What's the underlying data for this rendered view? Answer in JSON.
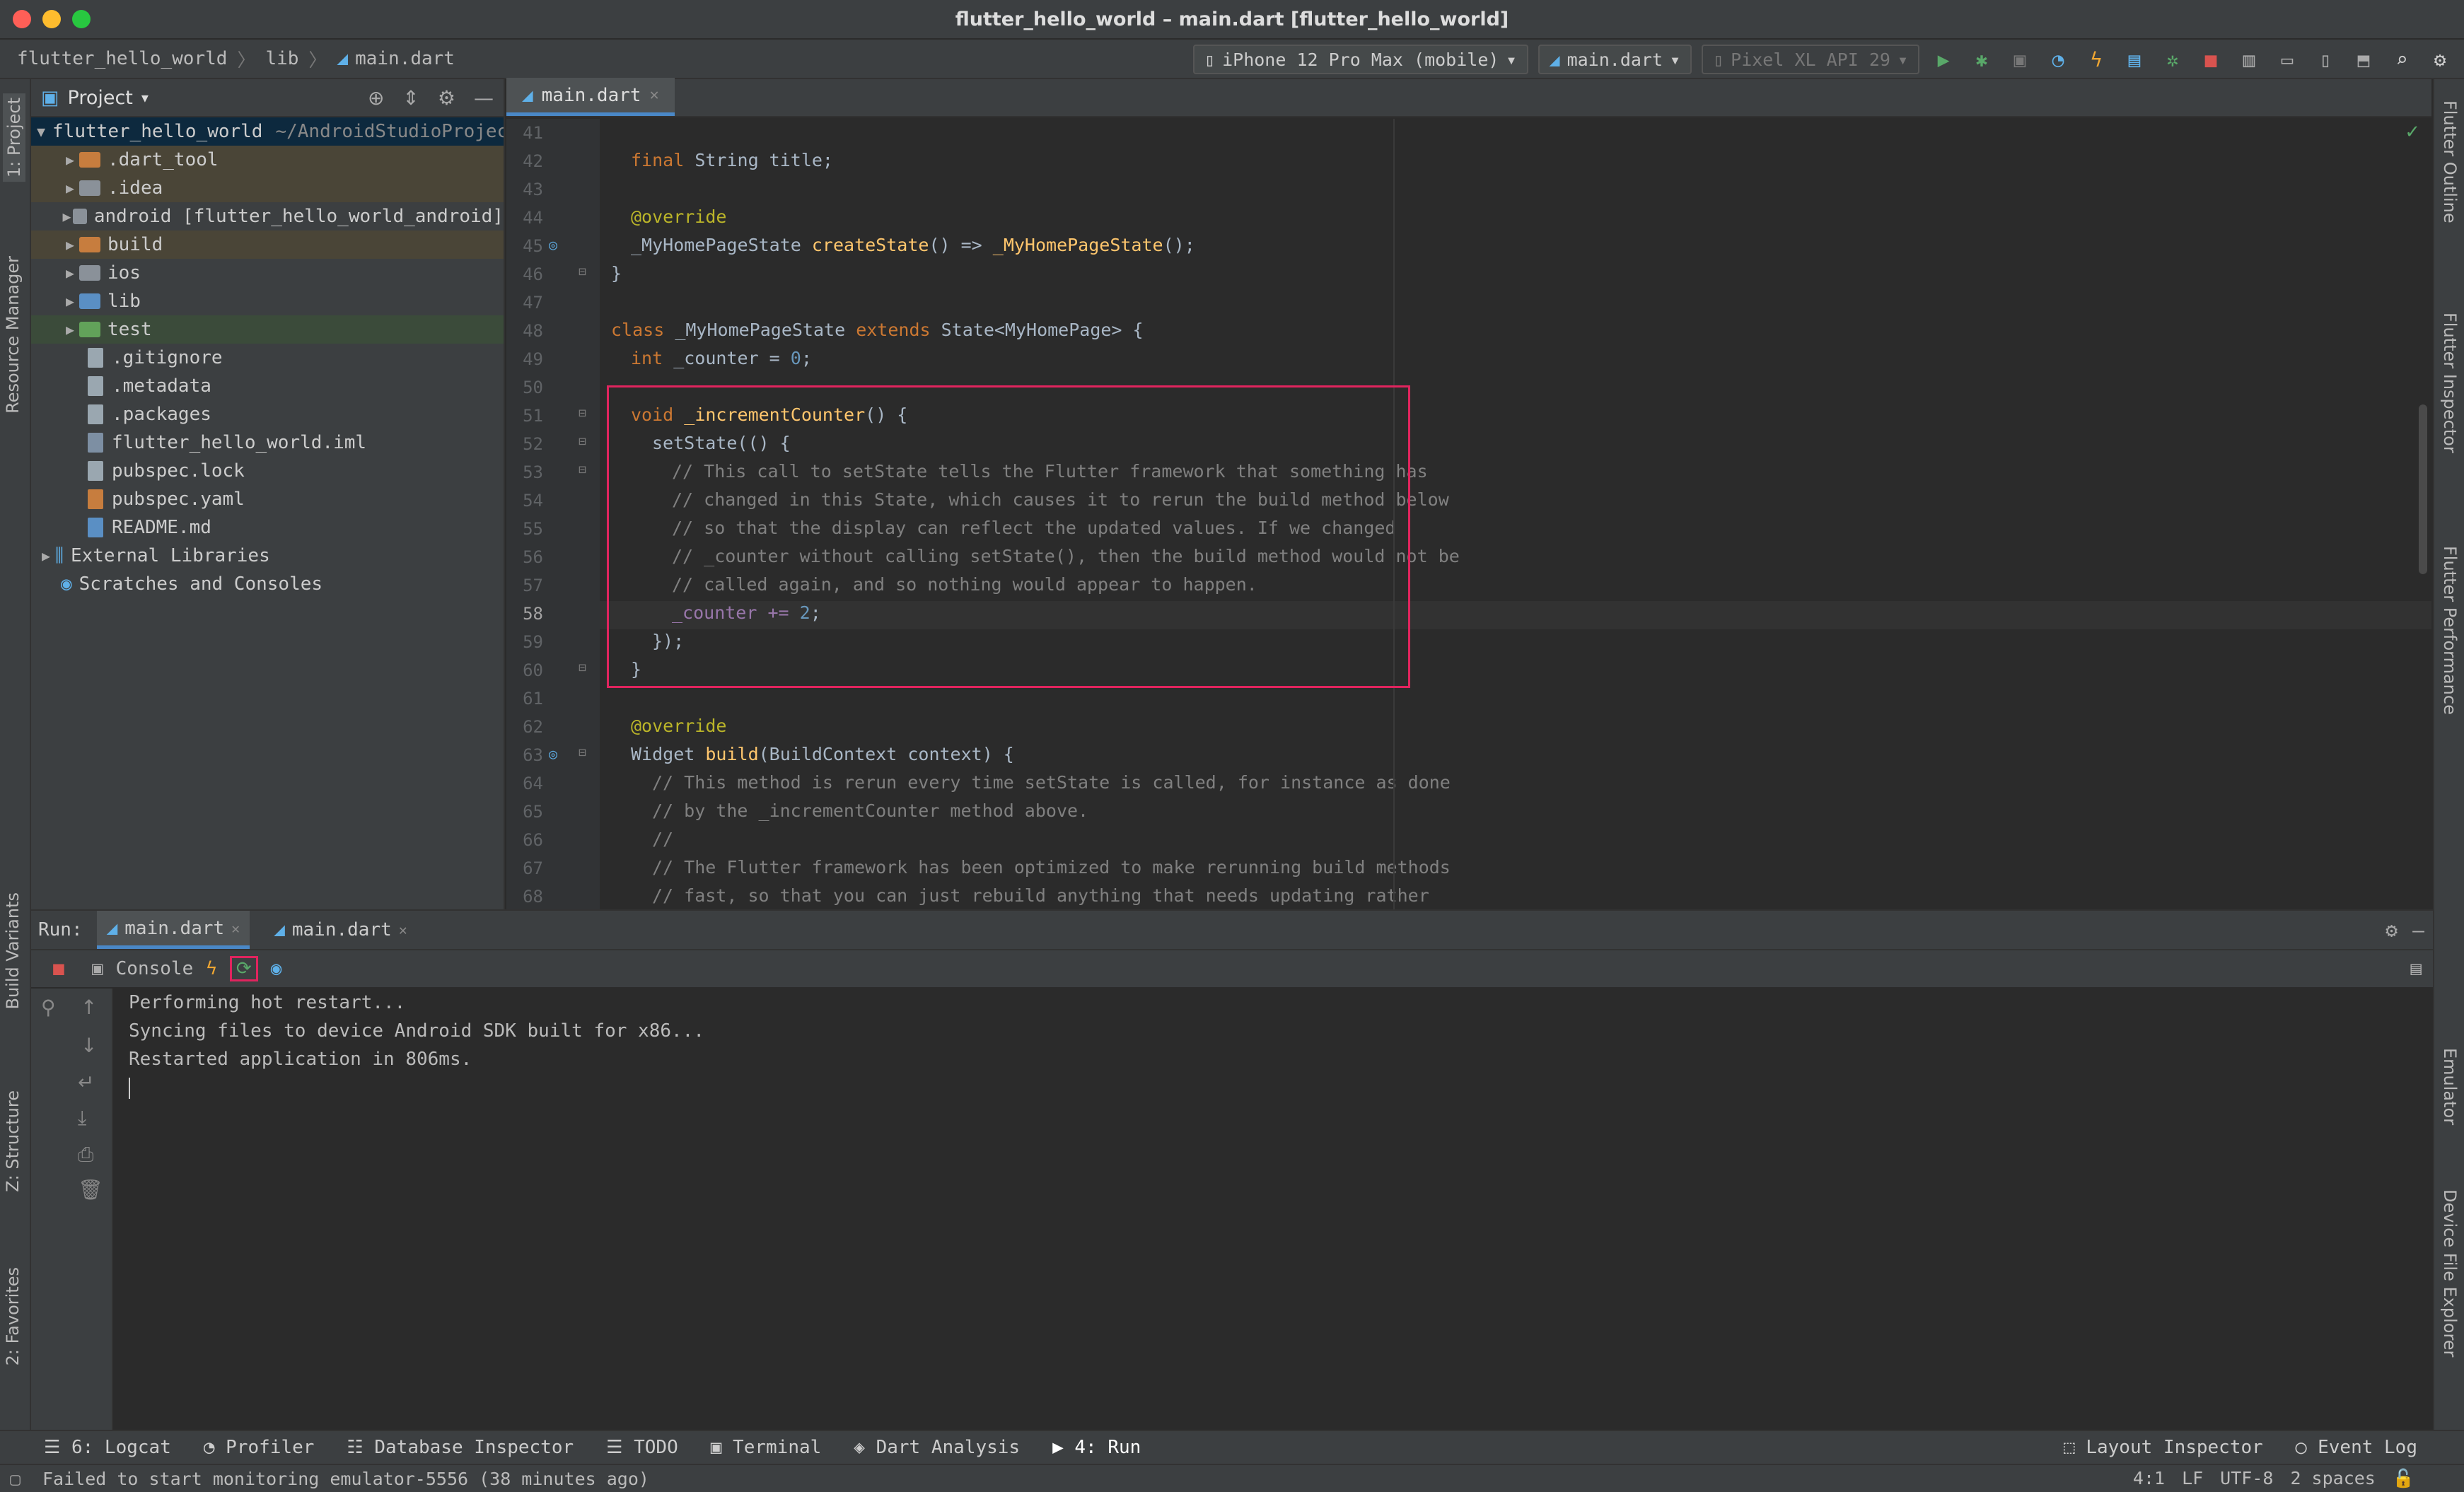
{
  "window": {
    "title": "flutter_hello_world – main.dart [flutter_hello_world]"
  },
  "breadcrumb": [
    "flutter_hello_world",
    "lib",
    "main.dart"
  ],
  "toolbar": {
    "device": "iPhone 12 Pro Max (mobile)",
    "config": "main.dart",
    "emulator": "Pixel XL API 29"
  },
  "left_stripe": [
    "1: Project",
    "Resource Manager",
    "Build Variants",
    "Z: Structure",
    "2: Favorites"
  ],
  "right_stripe": [
    "Flutter Outline",
    "Flutter Inspector",
    "Flutter Performance",
    "Emulator",
    "Device File Explorer"
  ],
  "project": {
    "title": "Project",
    "root_name": "flutter_hello_world",
    "root_path": "~/AndroidStudioProjec",
    "items": [
      {
        "label": ".dart_tool",
        "type": "folder"
      },
      {
        "label": ".idea",
        "type": "folder"
      },
      {
        "label": "android [flutter_hello_world_android]",
        "type": "folder"
      },
      {
        "label": "build",
        "type": "folder"
      },
      {
        "label": "ios",
        "type": "folder"
      },
      {
        "label": "lib",
        "type": "folder"
      },
      {
        "label": "test",
        "type": "folder"
      },
      {
        "label": ".gitignore",
        "type": "file"
      },
      {
        "label": ".metadata",
        "type": "file"
      },
      {
        "label": ".packages",
        "type": "file"
      },
      {
        "label": "flutter_hello_world.iml",
        "type": "file"
      },
      {
        "label": "pubspec.lock",
        "type": "file"
      },
      {
        "label": "pubspec.yaml",
        "type": "file"
      },
      {
        "label": "README.md",
        "type": "file"
      }
    ],
    "external": "External Libraries",
    "scratches": "Scratches and Consoles"
  },
  "editor": {
    "tab": "main.dart",
    "line_numbers": [
      "41",
      "42",
      "43",
      "44",
      "45",
      "46",
      "47",
      "48",
      "49",
      "50",
      "51",
      "52",
      "53",
      "54",
      "55",
      "56",
      "57",
      "58",
      "59",
      "60",
      "61",
      "62",
      "63",
      "64",
      "65",
      "66",
      "67",
      "68"
    ],
    "current_line": "58",
    "code": {
      "l42_kw": "final",
      "l42_rest": " String title;",
      "l44": "@override",
      "l45_a": "_MyHomePageState ",
      "l45_fn": "createState",
      "l45_b": "() => ",
      "l45_fn2": "_MyHomePageState",
      "l45_c": "();",
      "l46": "}",
      "l48_kw": "class",
      "l48_a": " _MyHomePageState ",
      "l48_kw2": "extends",
      "l48_b": " State<MyHomePage> {",
      "l49_kw": "int",
      "l49_a": " _counter = ",
      "l49_num": "0",
      "l49_b": ";",
      "l51_kw": "void",
      "l51_fn": " _incrementCounter",
      "l51_a": "() {",
      "l52": "setState(() {",
      "l53": "// This call to setState tells the Flutter framework that something has",
      "l54": "// changed in this State, which causes it to rerun the build method below",
      "l55": "// so that the display can reflect the updated values. If we changed",
      "l56": "// _counter without calling setState(), then the build method would not be",
      "l57": "// called again, and so nothing would appear to happen.",
      "l58_a": "_counter += ",
      "l58_num": "2",
      "l58_b": ";",
      "l59": "});",
      "l60": "}",
      "l62": "@override",
      "l63_a": "Widget ",
      "l63_fn": "build",
      "l63_b": "(BuildContext context) {",
      "l64": "// This method is rerun every time setState is called, for instance as done",
      "l65": "// by the _incrementCounter method above.",
      "l66": "//",
      "l67": "// The Flutter framework has been optimized to make rerunning build methods",
      "l68": "// fast, so that you can just rebuild anything that needs updating rather"
    }
  },
  "run": {
    "label": "Run:",
    "tabs": [
      "main.dart",
      "main.dart"
    ],
    "console_label": "Console",
    "output": [
      "Performing hot restart...",
      "Syncing files to device Android SDK built for x86...",
      "Restarted application in 806ms."
    ]
  },
  "bottom_tabs": {
    "left": [
      "6: Logcat",
      "Profiler",
      "Database Inspector",
      "TODO",
      "Terminal",
      "Dart Analysis",
      "4: Run"
    ],
    "right": [
      "Layout Inspector",
      "Event Log"
    ]
  },
  "status": {
    "message": "Failed to start monitoring emulator-5556 (38 minutes ago)",
    "position": "4:1",
    "line_sep": "LF",
    "encoding": "UTF-8",
    "indent": "2 spaces"
  },
  "colors": {
    "highlight_box": "#e0245e",
    "accent": "#4a88c7"
  }
}
